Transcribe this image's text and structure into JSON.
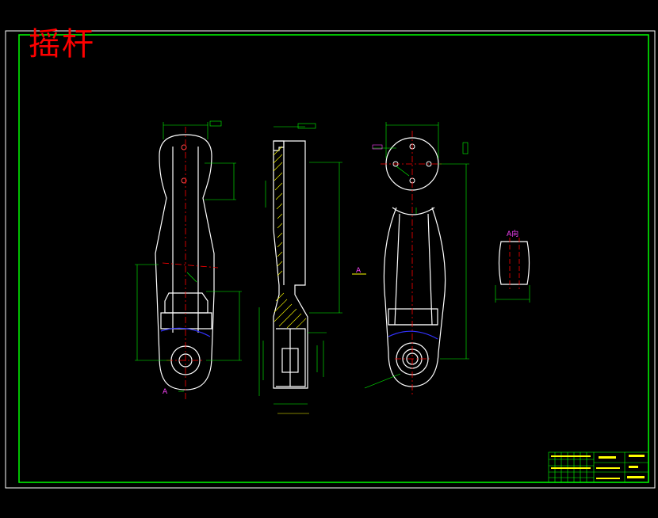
{
  "drawing": {
    "title": "摇杆",
    "section_label": "A",
    "view_label": "A向"
  },
  "colors": {
    "background": "#000000",
    "frame_outer": "#ffffff",
    "frame_inner": "#00ff00",
    "outline": "#ffffff",
    "dimension": "#00ff00",
    "centerline": "#ff0000",
    "hatch": "#ffff00",
    "hidden_arc": "#3333ff",
    "title_text": "#ff0000",
    "annotation": "#ff44ff"
  }
}
